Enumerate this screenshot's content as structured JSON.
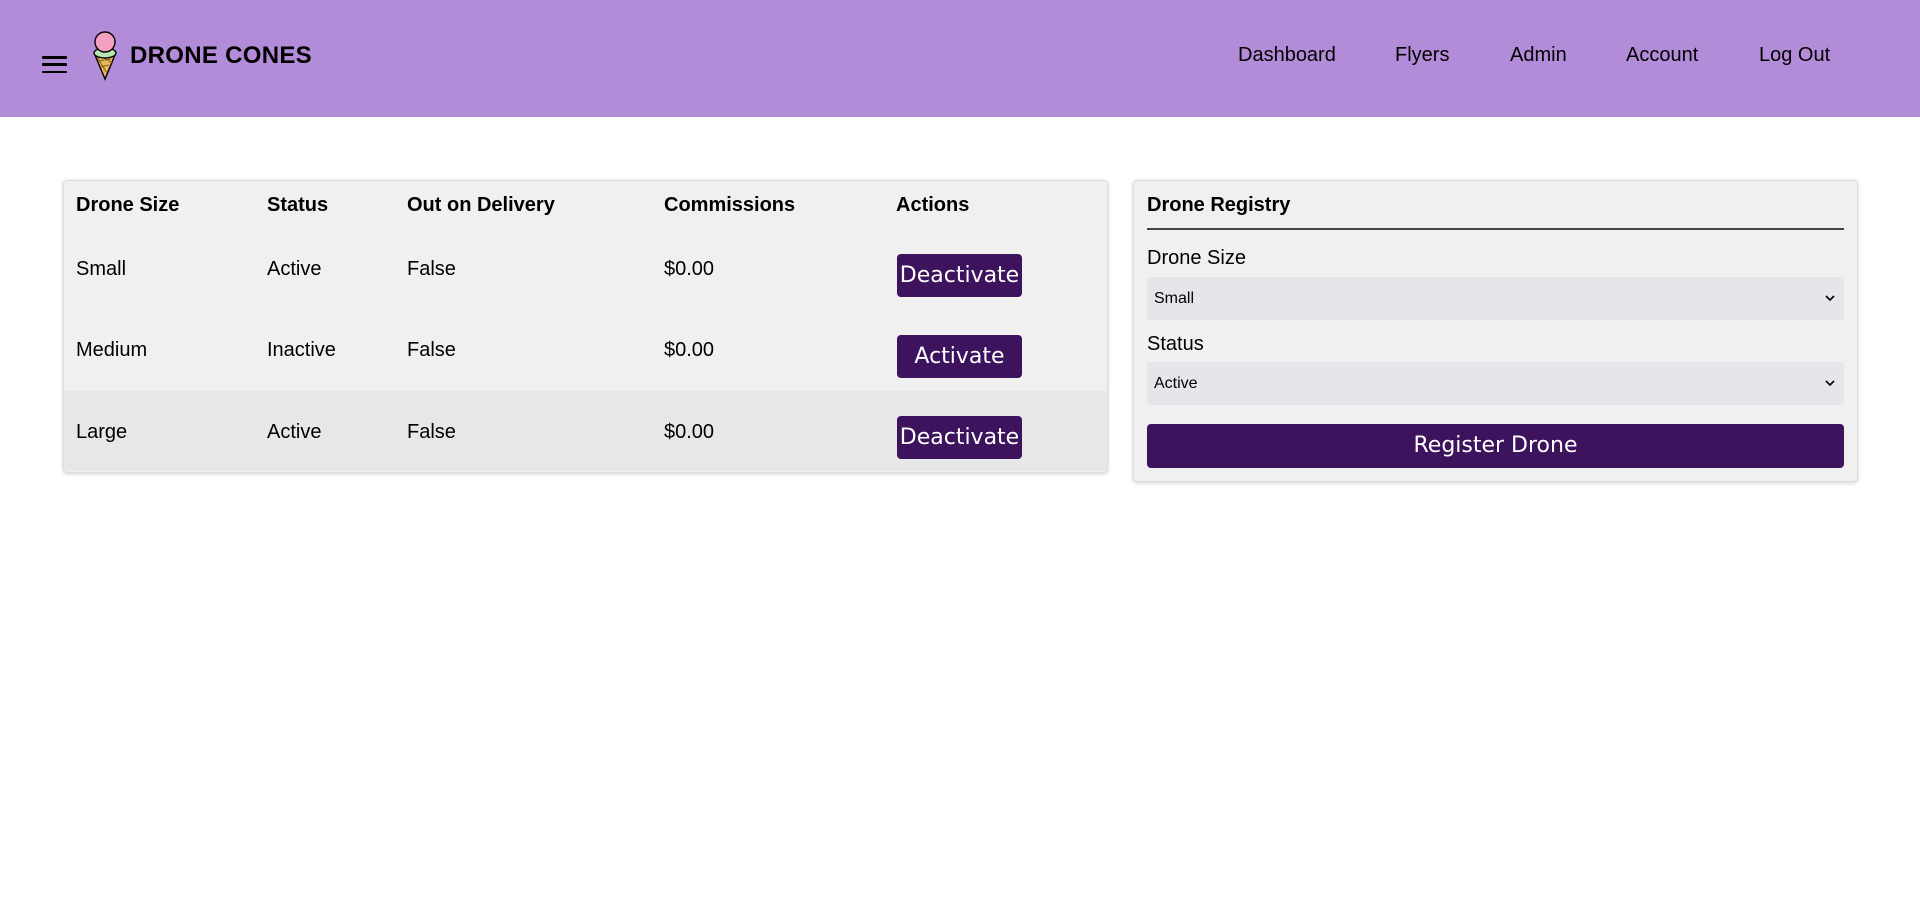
{
  "app": {
    "brand": "DRONE CONES",
    "nav": [
      "Dashboard",
      "Flyers",
      "Admin",
      "Account",
      "Log Out"
    ]
  },
  "table": {
    "headers": [
      "Drone Size",
      "Status",
      "Out on Delivery",
      "Commissions",
      "Actions"
    ],
    "rows": [
      {
        "size": "Small",
        "status": "Active",
        "out": "False",
        "commission": "$0.00",
        "action": "Deactivate"
      },
      {
        "size": "Medium",
        "status": "Inactive",
        "out": "False",
        "commission": "$0.00",
        "action": "Activate"
      },
      {
        "size": "Large",
        "status": "Active",
        "out": "False",
        "commission": "$0.00",
        "action": "Deactivate"
      }
    ]
  },
  "registry": {
    "title": "Drone Registry",
    "size_label": "Drone Size",
    "size_value": "Small",
    "status_label": "Status",
    "status_value": "Active",
    "submit": "Register Drone"
  },
  "colors": {
    "header_bg": "#b38cd9",
    "button_bg": "#3c135c",
    "card_bg": "#f1f0f1"
  },
  "icons": {
    "menu": "hamburger-menu-icon",
    "logo": "ice-cream-cone-icon",
    "select": "chevron-down-icon"
  }
}
